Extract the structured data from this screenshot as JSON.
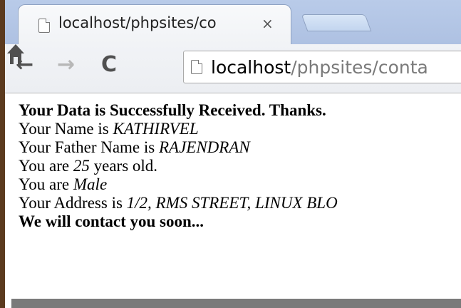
{
  "tab": {
    "title": "localhost/phpsites/co",
    "close_glyph": "×"
  },
  "toolbar": {
    "back_glyph": "←",
    "forward_glyph": "→",
    "reload_glyph": "C"
  },
  "address_bar": {
    "host": "localhost",
    "path": "/phpsites/conta"
  },
  "page": {
    "heading": "Your Data is Successfully Received. Thanks.",
    "name_label": "Your Name is ",
    "name_value": "KATHIRVEL",
    "father_label": "Your Father Name is ",
    "father_value": "RAJENDRAN",
    "age_prefix": "You are ",
    "age_value": "25",
    "age_suffix": " years old.",
    "gender_prefix": "You are ",
    "gender_value": "Male",
    "address_label": "Your Address is ",
    "address_value": "1/2, RMS STREET, LINUX BLO",
    "footer": "We will contact you soon..."
  },
  "icons": {
    "tab_page": "page-icon",
    "address_page": "page-icon",
    "home": "home-icon"
  },
  "colors": {
    "tab_strip": "#b9cbe9",
    "toolbar": "#eceef2",
    "left_edge": "#5b3a1e",
    "scrollbar": "#7a7a7a"
  }
}
